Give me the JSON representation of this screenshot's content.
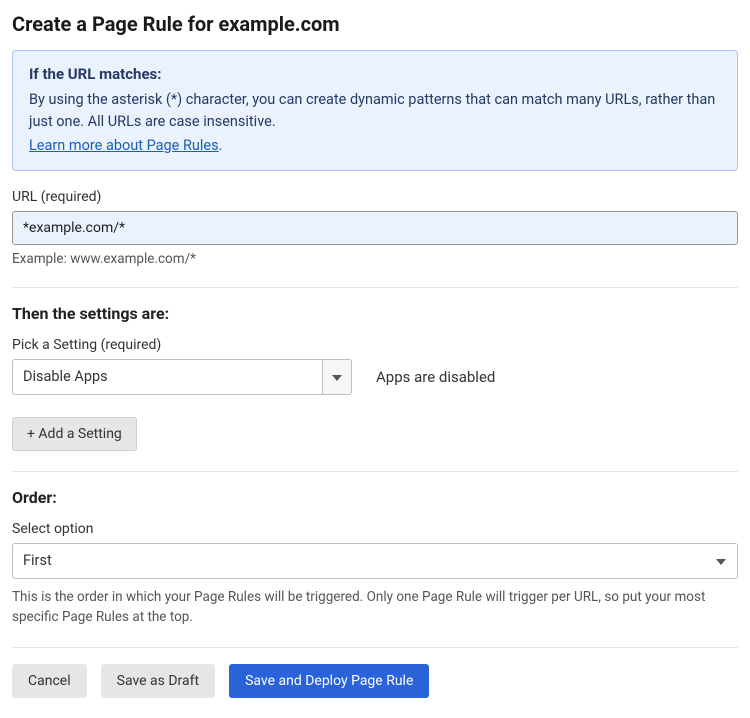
{
  "title": "Create a Page Rule for example.com",
  "infoBox": {
    "heading": "If the URL matches:",
    "body": "By using the asterisk (*) character, you can create dynamic patterns that can match many URLs, rather than just one. All URLs are case insensitive.",
    "linkText": "Learn more about Page Rules"
  },
  "url": {
    "label": "URL (required)",
    "value": "*example.com/*",
    "example": "Example: www.example.com/*"
  },
  "settings": {
    "heading": "Then the settings are:",
    "pickLabel": "Pick a Setting (required)",
    "selectedSetting": "Disable Apps",
    "settingDescription": "Apps are disabled",
    "addButton": "+ Add a Setting"
  },
  "order": {
    "heading": "Order:",
    "label": "Select option",
    "value": "First",
    "help": "This is the order in which your Page Rules will be triggered. Only one Page Rule will trigger per URL, so put your most specific Page Rules at the top."
  },
  "buttons": {
    "cancel": "Cancel",
    "draft": "Save as Draft",
    "deploy": "Save and Deploy Page Rule"
  }
}
